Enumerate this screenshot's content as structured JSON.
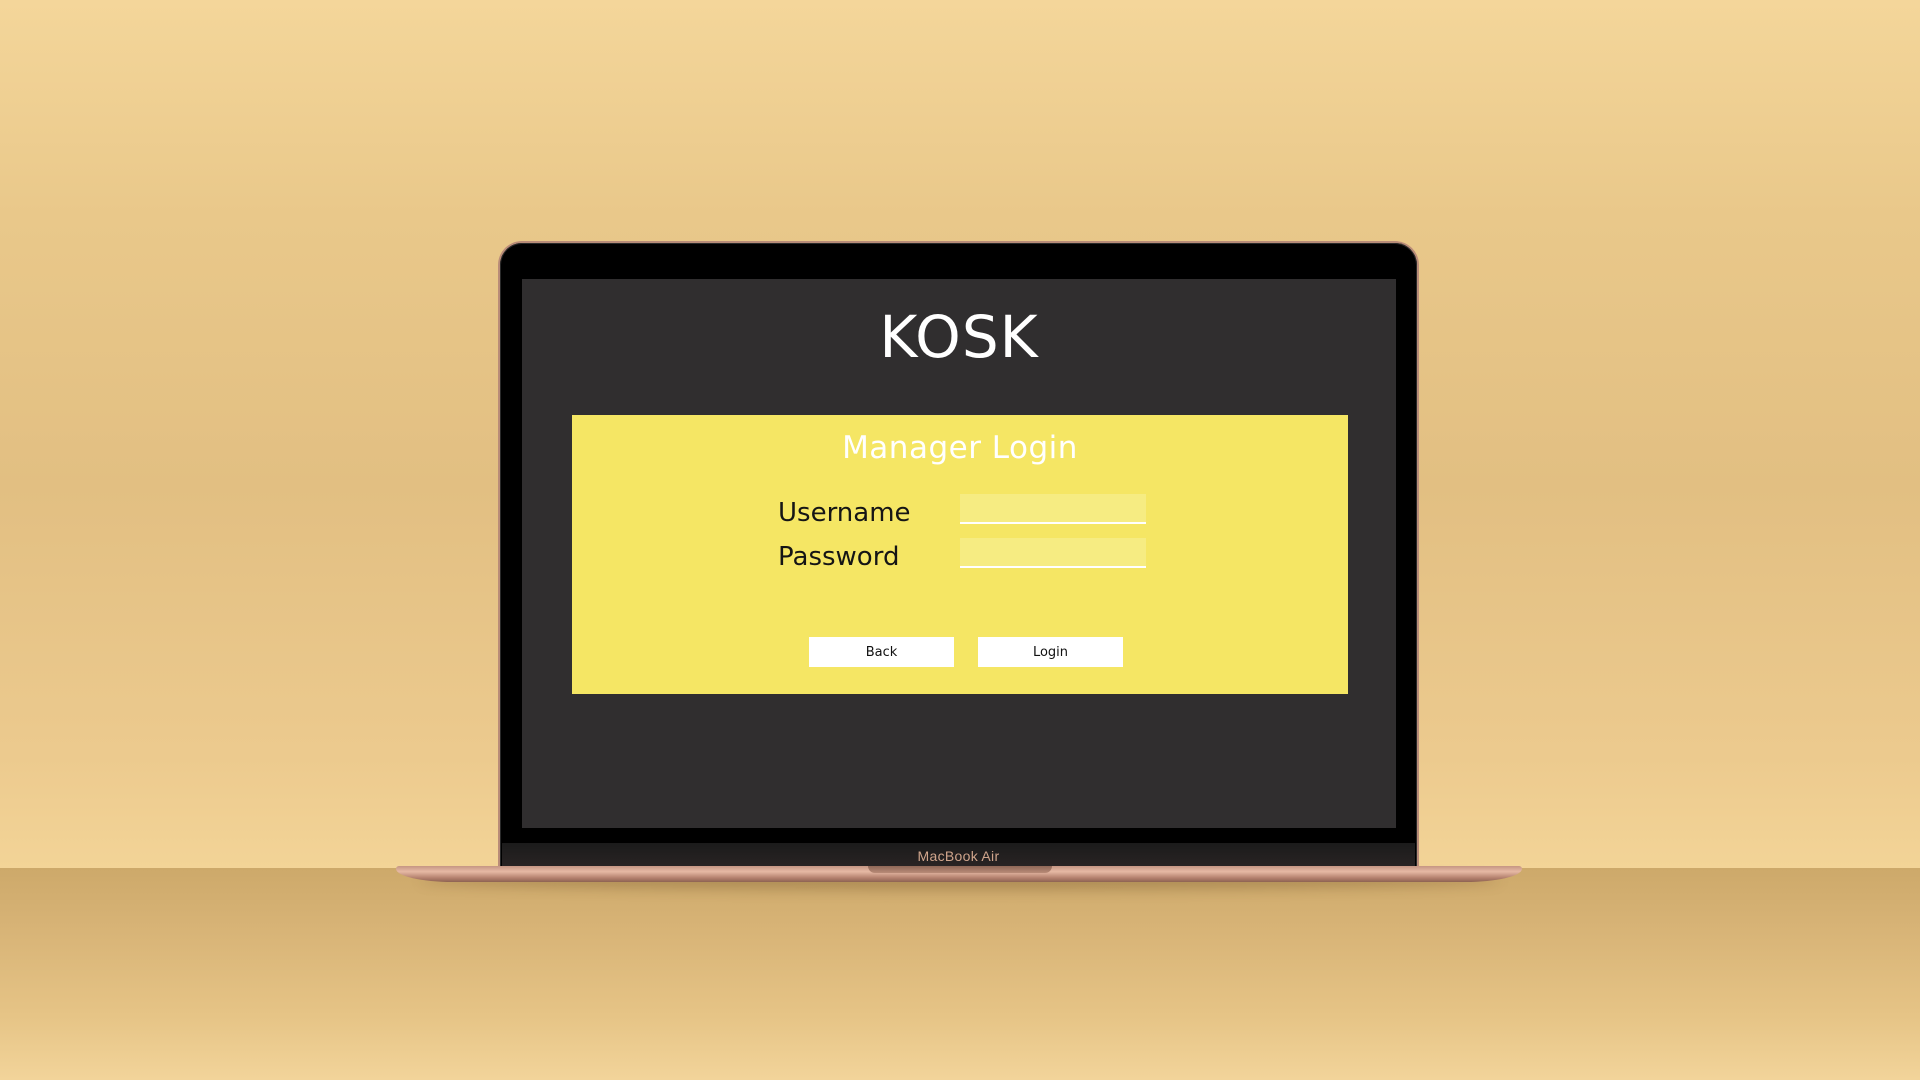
{
  "device": {
    "model_label": "MacBook Air"
  },
  "app": {
    "logo_text": "KOSK"
  },
  "login_panel": {
    "title": "Manager Login",
    "username": {
      "label": "Username",
      "value": "",
      "placeholder": ""
    },
    "password": {
      "label": "Password",
      "value": "",
      "placeholder": ""
    },
    "buttons": {
      "back_label": "Back",
      "login_label": "Login"
    }
  },
  "colors": {
    "background_top": "#f4d69a",
    "table_surface": "#d8b477",
    "screen_background": "#302e2f",
    "panel_accent": "#f5e664",
    "input_fill": "#f6ec82",
    "button_fill": "#ffffff",
    "laptop_body": "#c59683"
  }
}
